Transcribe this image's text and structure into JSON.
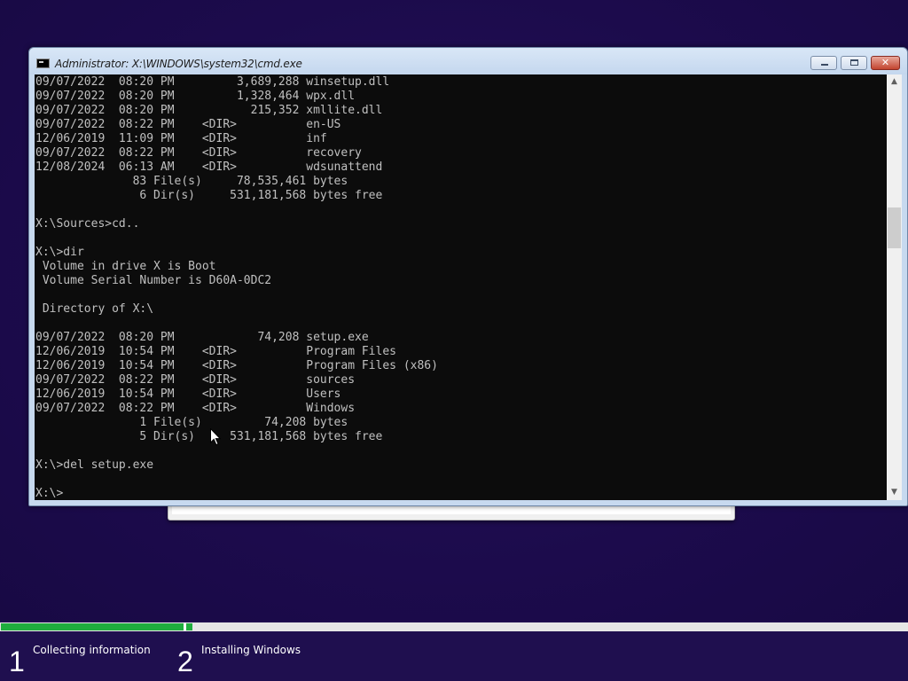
{
  "window": {
    "title": "Administrator: X:\\WINDOWS\\system32\\cmd.exe",
    "close_glyph": "✕"
  },
  "console": {
    "lines": [
      "09/07/2022  08:20 PM         3,689,288 winsetup.dll",
      "09/07/2022  08:20 PM         1,328,464 wpx.dll",
      "09/07/2022  08:20 PM           215,352 xmllite.dll",
      "09/07/2022  08:22 PM    <DIR>          en-US",
      "12/06/2019  11:09 PM    <DIR>          inf",
      "09/07/2022  08:22 PM    <DIR>          recovery",
      "12/08/2024  06:13 AM    <DIR>          wdsunattend",
      "              83 File(s)     78,535,461 bytes",
      "               6 Dir(s)     531,181,568 bytes free",
      "",
      "X:\\Sources>cd..",
      "",
      "X:\\>dir",
      " Volume in drive X is Boot",
      " Volume Serial Number is D60A-0DC2",
      "",
      " Directory of X:\\",
      "",
      "09/07/2022  08:20 PM            74,208 setup.exe",
      "12/06/2019  10:54 PM    <DIR>          Program Files",
      "12/06/2019  10:54 PM    <DIR>          Program Files (x86)",
      "09/07/2022  08:22 PM    <DIR>          sources",
      "12/06/2019  10:54 PM    <DIR>          Users",
      "09/07/2022  08:22 PM    <DIR>          Windows",
      "               1 File(s)         74,208 bytes",
      "               5 Dir(s)     531,181,568 bytes free",
      "",
      "X:\\>del setup.exe",
      "",
      "X:\\>"
    ],
    "text_color": "#c0c0c0",
    "background_color": "#0c0c0c"
  },
  "icons": {
    "window_icon": "cmd-icon",
    "minimize": "minimize-icon",
    "maximize": "maximize-icon",
    "close": "close-icon",
    "scroll_up": "chevron-up-icon",
    "scroll_down": "chevron-down-icon",
    "pointer": "mouse-pointer-icon"
  },
  "scrollbar": {
    "up_glyph": "▲",
    "down_glyph": "▼"
  },
  "progress": {
    "accent_color": "#1fad3e"
  },
  "steps": [
    {
      "number": "1",
      "label": "Collecting information"
    },
    {
      "number": "2",
      "label": "Installing Windows"
    }
  ]
}
